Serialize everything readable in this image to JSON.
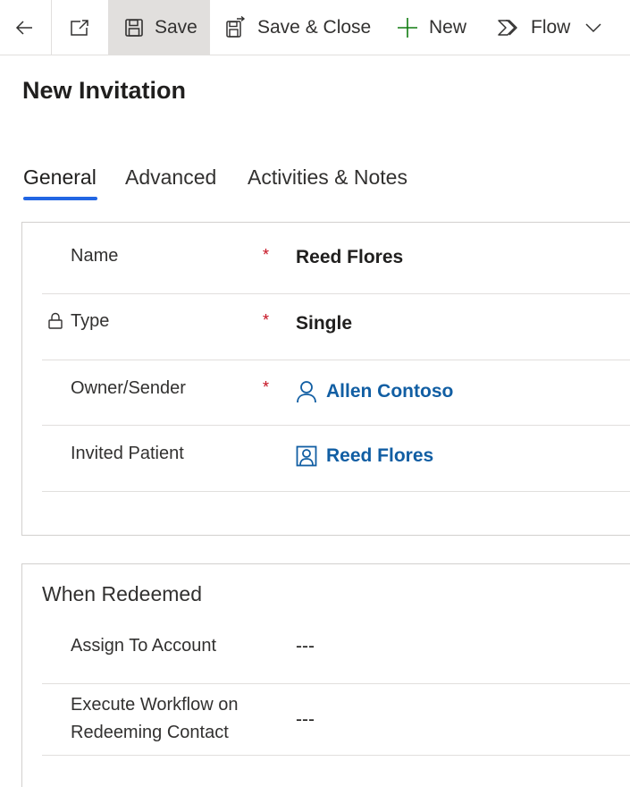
{
  "toolbar": {
    "save_label": "Save",
    "save_close_label": "Save & Close",
    "new_label": "New",
    "flow_label": "Flow"
  },
  "page": {
    "title": "New Invitation"
  },
  "tabs": [
    {
      "label": "General",
      "selected": true
    },
    {
      "label": "Advanced",
      "selected": false
    },
    {
      "label": "Activities & Notes",
      "selected": false
    }
  ],
  "general": {
    "fields": [
      {
        "label": "Name",
        "required": "*",
        "value": "Reed Flores"
      },
      {
        "label": "Type",
        "required": "*",
        "value": "Single"
      },
      {
        "label": "Owner/Sender",
        "required": "*",
        "value": "Allen Contoso"
      },
      {
        "label": "Invited Patient",
        "value": "Reed Flores"
      }
    ]
  },
  "redeem": {
    "title": "When Redeemed",
    "fields": [
      {
        "label": "Assign To Account",
        "value": "---"
      },
      {
        "label_line1": "Execute Workflow on",
        "label_line2": "Redeeming Contact",
        "value": "---"
      }
    ]
  },
  "colors": {
    "accent": "#2266e3",
    "link": "#115ea3",
    "required": "#c50f1f",
    "save_bg": "#e1dfdd",
    "new_icon": "#107c10"
  },
  "icons": [
    "back-arrow-icon",
    "popout-icon",
    "save-icon",
    "save-close-icon",
    "plus-icon",
    "flow-icon",
    "chevron-down-icon",
    "lock-icon",
    "user-icon",
    "contact-card-icon"
  ]
}
